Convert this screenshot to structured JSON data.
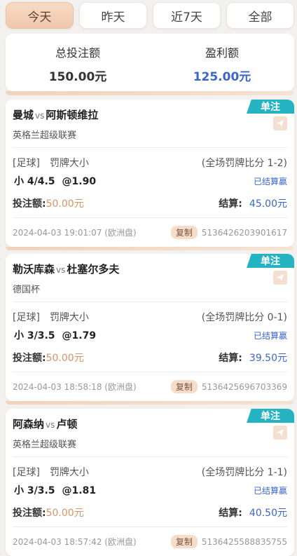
{
  "tabs": [
    {
      "label": "今天",
      "active": true
    },
    {
      "label": "昨天",
      "active": false
    },
    {
      "label": "近7天",
      "active": false
    },
    {
      "label": "全部",
      "active": false
    }
  ],
  "summary": {
    "stake_label": "总投注额",
    "stake_value": "150.00元",
    "profit_label": "盈利额",
    "profit_value": "125.00元"
  },
  "colors": {
    "accent": "#25b2c1",
    "profit_blue": "#3c66c9",
    "stake_orange": "#d99464",
    "tab_active": "#f1c7ab"
  },
  "labels": {
    "vs": "vs",
    "stake": "投注额:",
    "settle": "结算:",
    "copy": "复制",
    "ribbon": "单注"
  },
  "bets": [
    {
      "home": "曼城",
      "away": "阿斯顿维拉",
      "league": "英格兰超级联赛",
      "sport": "[足球]",
      "market": "罚牌大小",
      "period": "(全场罚牌比分 1-2)",
      "pick": "小 4/4.5",
      "odds": "@1.90",
      "result": "已结算赢",
      "stake": "50.00元",
      "settle": "45.00元",
      "time": "2024-04-03 19:01:07 (欧洲盘)",
      "order_no": "5136426203901617"
    },
    {
      "home": "勒沃库森",
      "away": "杜塞尔多夫",
      "league": "德国杯",
      "sport": "[足球]",
      "market": "罚牌大小",
      "period": "(全场罚牌比分 0-1)",
      "pick": "小 3/3.5",
      "odds": "@1.79",
      "result": "已结算赢",
      "stake": "50.00元",
      "settle": "39.50元",
      "time": "2024-04-03 18:58:18 (欧洲盘)",
      "order_no": "5136425696703369"
    },
    {
      "home": "阿森纳",
      "away": "卢顿",
      "league": "英格兰超级联赛",
      "sport": "[足球]",
      "market": "罚牌大小",
      "period": "(全场罚牌比分 1-1)",
      "pick": "小 3/3.5",
      "odds": "@1.81",
      "result": "已结算赢",
      "stake": "50.00元",
      "settle": "40.50元",
      "time": "2024-04-03 18:57:42 (欧洲盘)",
      "order_no": "5136425588835755"
    }
  ]
}
